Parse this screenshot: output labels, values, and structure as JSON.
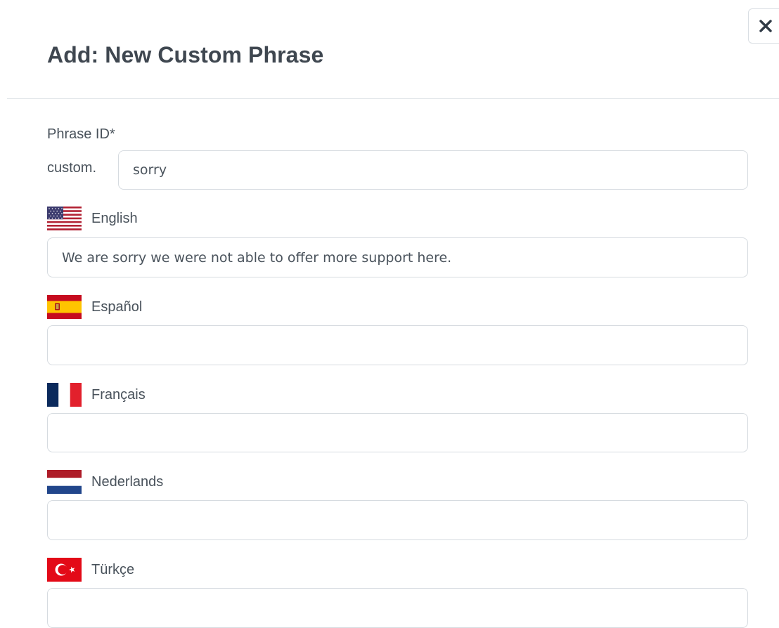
{
  "dialog": {
    "title": "Add: New Custom Phrase",
    "close_icon": "close-icon"
  },
  "phrase_id": {
    "label": "Phrase ID*",
    "prefix": "custom.",
    "value": "sorry"
  },
  "languages": [
    {
      "name": "English",
      "flag_icon": "us-flag-icon",
      "value": "We are sorry we were not able to offer more support here."
    },
    {
      "name": "Español",
      "flag_icon": "spain-flag-icon",
      "value": ""
    },
    {
      "name": "Français",
      "flag_icon": "france-flag-icon",
      "value": ""
    },
    {
      "name": "Nederlands",
      "flag_icon": "netherlands-flag-icon",
      "value": ""
    },
    {
      "name": "Türkçe",
      "flag_icon": "turkey-flag-icon",
      "value": ""
    }
  ],
  "colors": {
    "text": "#49525b",
    "border": "#d6dbe0",
    "divider": "#dfe3e7"
  }
}
